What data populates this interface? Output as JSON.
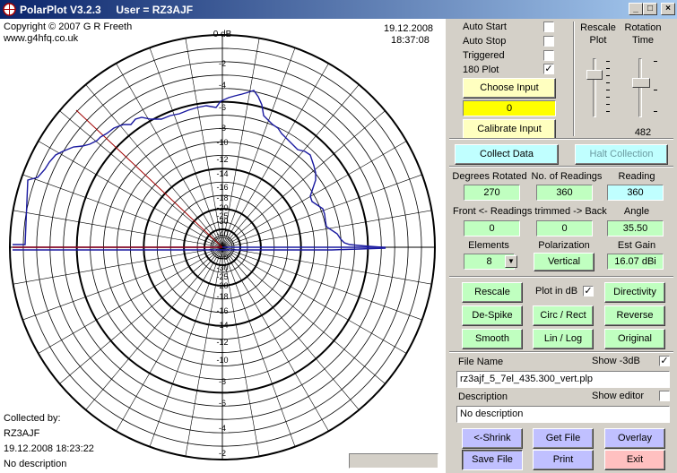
{
  "window": {
    "title": "PolarPlot V3.2.3     User = RZ3AJF",
    "minimize": "_",
    "maximize": "□",
    "close": "×"
  },
  "plot": {
    "copyright": "Copyright © 2007 G R Freeth",
    "website": "www.g4hfq.co.uk",
    "date": "19.12.2008",
    "time": "18:37:08",
    "zero_label": "0 dB",
    "ring_labels_top": [
      "-2",
      "-4",
      "-6",
      "-8",
      "-10",
      "-12",
      "-14",
      "-16",
      "-18",
      "-20",
      "-25",
      "-30",
      "-40"
    ],
    "ring_labels_bottom": [
      "-40",
      "-30",
      "-25",
      "-20",
      "-18",
      "-16",
      "-14",
      "-12",
      "-10",
      "-8",
      "-6",
      "-4",
      "-2"
    ],
    "collected_by_label": "Collected by:",
    "collector": "RZ3AJF",
    "collected_at": "19.12.2008 18:23:22",
    "description": "No description",
    "colors": {
      "pattern": "#1a1aa0",
      "reference": "#a00000",
      "grid": "#000000"
    }
  },
  "controls": {
    "auto_start": {
      "label": "Auto Start",
      "checked": false
    },
    "auto_stop": {
      "label": "Auto Stop",
      "checked": false
    },
    "triggered": {
      "label": "Triggered",
      "checked": false
    },
    "plot_180": {
      "label": "180 Plot",
      "checked": true
    },
    "choose_input": "Choose Input",
    "input_value": "0",
    "calibrate_input": "Calibrate Input",
    "rescale_plot_label_1": "Rescale",
    "rescale_plot_label_2": "Plot",
    "rotation_time_label_1": "Rotation",
    "rotation_time_label_2": "Time",
    "rotation_time_value": "482",
    "collect_data": "Collect Data",
    "halt_collection": "Halt Collection"
  },
  "readings": {
    "degrees_rotated_label": "Degrees Rotated",
    "degrees_rotated": "270",
    "no_of_readings_label": "No. of Readings",
    "no_of_readings": "360",
    "reading_label": "Reading",
    "reading": "360",
    "trim_label": "Front <- Readings trimmed -> Back",
    "front": "0",
    "back": "0",
    "angle_label": "Angle",
    "angle": "35.50",
    "elements_label": "Elements",
    "elements": "8",
    "polarization_label": "Polarization",
    "polarization": "Vertical",
    "est_gain_label": "Est Gain",
    "est_gain": "16.07 dBi"
  },
  "actions": {
    "rescale": "Rescale",
    "plot_in_db": {
      "label": "Plot in dB",
      "checked": true
    },
    "directivity": "Directivity",
    "despike": "De-Spike",
    "circ_rect": "Circ / Rect",
    "reverse": "Reverse",
    "smooth": "Smooth",
    "lin_log": "Lin / Log",
    "original": "Original"
  },
  "file": {
    "file_name_label": "File Name",
    "show_3db": {
      "label": "Show -3dB",
      "checked": true
    },
    "file_name": "rz3ajf_5_7el_435.300_vert.plp",
    "description_label": "Description",
    "show_editor": {
      "label": "Show editor",
      "checked": false
    },
    "description": "No description",
    "shrink": "<-Shrink",
    "get_file": "Get File",
    "overlay": "Overlay",
    "save_file": "Save File",
    "print": "Print",
    "exit": "Exit"
  }
}
